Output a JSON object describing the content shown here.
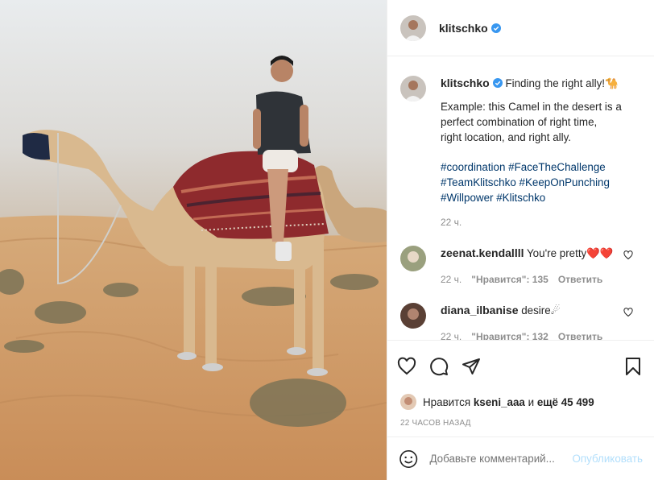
{
  "post": {
    "username": "klitschko",
    "verified": true,
    "photo_alt": "Man riding a camel in the desert"
  },
  "caption": {
    "username": "klitschko",
    "line1": "Finding the right ally!🐪",
    "paragraph": [
      "Example: this Camel in the desert is a",
      "perfect combination of right time,",
      "right location, and right ally."
    ],
    "hashtags_lines": [
      [
        "#coordination",
        "#FaceTheChallenge"
      ],
      [
        "#TeamKlitschko",
        "#KeepOnPunching"
      ],
      [
        "#Willpower",
        "#Klitschko"
      ]
    ],
    "time": "22 ч."
  },
  "comments": [
    {
      "username": "zeenat.kendallll",
      "text": "You're pretty❤️❤️",
      "time": "22 ч.",
      "likes": "\"Нравится\": 135",
      "reply": "Ответить"
    },
    {
      "username": "diana_ilbanise",
      "text": "desire☄",
      "time": "22 ч.",
      "likes": "\"Нравится\": 132",
      "reply": "Ответить"
    }
  ],
  "likes": {
    "prefix": "Нравится",
    "user": "kseni_aaa",
    "middle": "и",
    "rest": "ещё 45 499"
  },
  "time_ago": "22 ЧАСОВ НАЗАД",
  "add_comment": {
    "placeholder": "Добавьте комментарий...",
    "publish": "Опубликовать"
  },
  "icons": {
    "like": "heart-icon",
    "comment": "comment-icon",
    "share": "send-icon",
    "save": "bookmark-icon",
    "emoji": "smiley-icon",
    "verified": "verified-badge-icon"
  },
  "colors": {
    "verified_blue": "#3897f0",
    "hashtag": "#00376b",
    "muted": "#8e8e8e",
    "publish_disabled": "#b2dffc"
  }
}
